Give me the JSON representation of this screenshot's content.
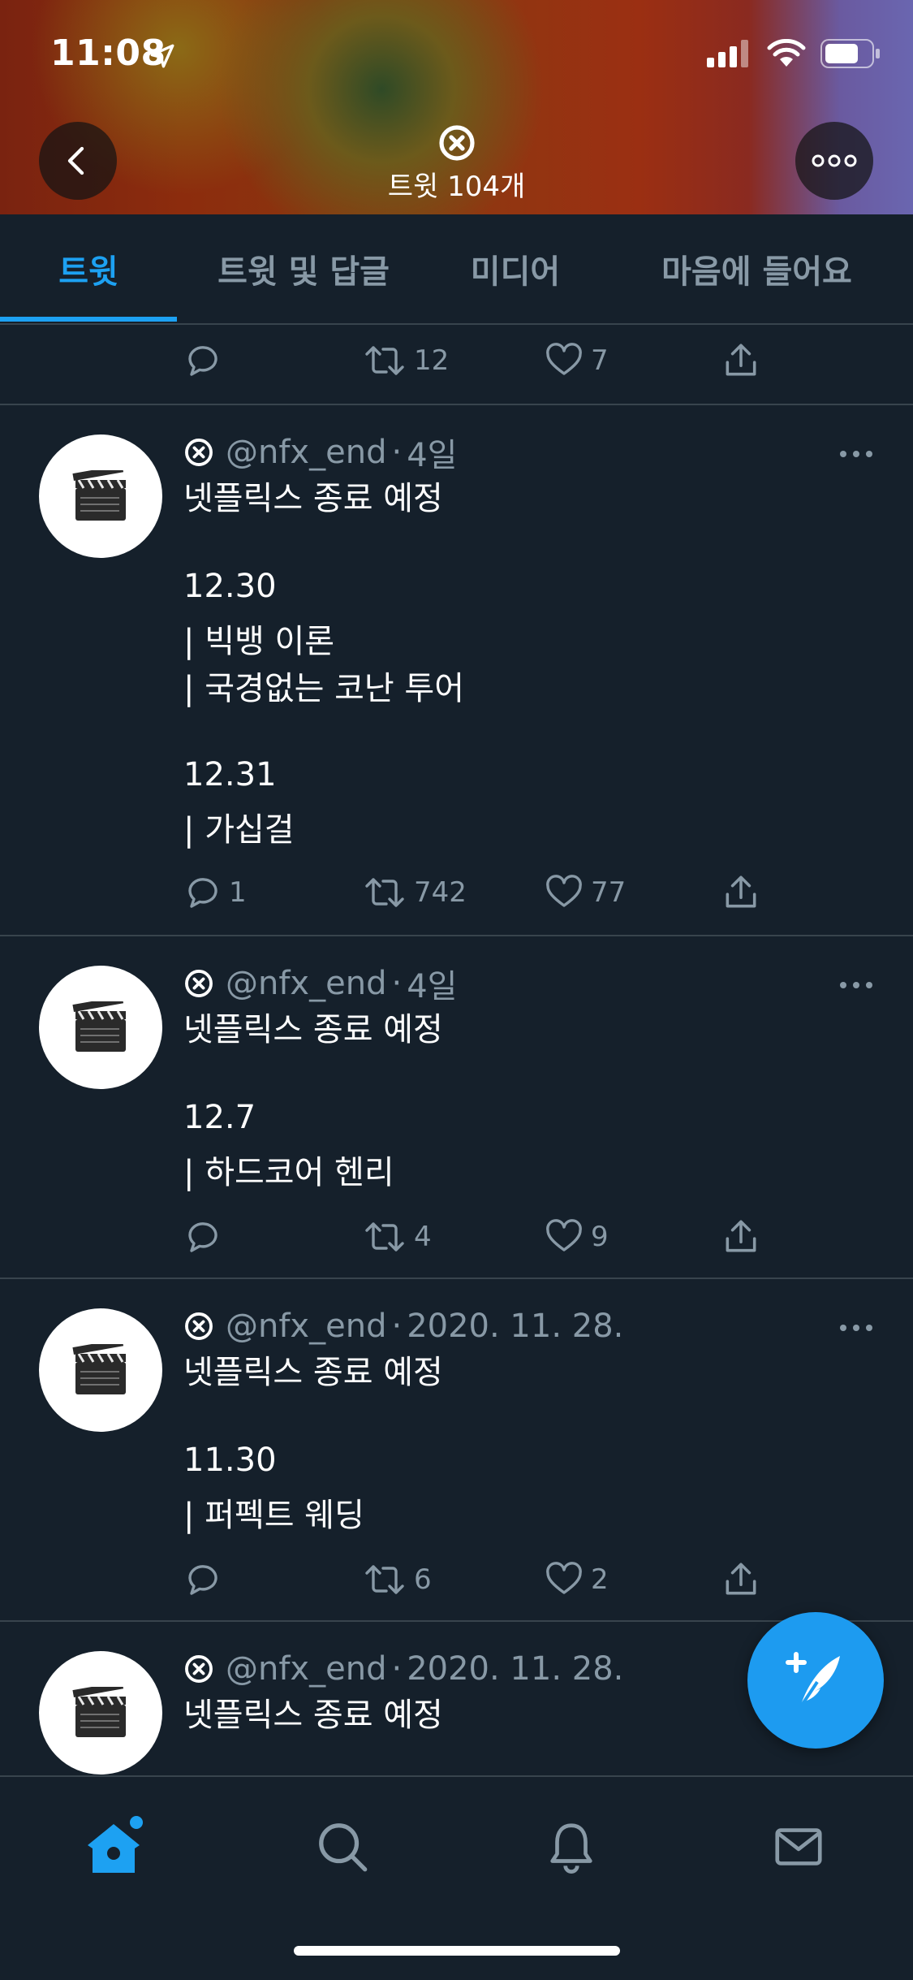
{
  "status_bar": {
    "time": "11:08"
  },
  "header": {
    "tweet_count": "트윗 104개"
  },
  "tabs": [
    {
      "label": "트윗",
      "active": true
    },
    {
      "label": "트윗 및 답글",
      "active": false
    },
    {
      "label": "미디어",
      "active": false
    },
    {
      "label": "마음에 들어요",
      "active": false
    }
  ],
  "partial_tweet_actions": {
    "replies": "",
    "retweets": "12",
    "likes": "7"
  },
  "tweets": [
    {
      "handle": "@nfx_end",
      "time": "4일",
      "lines": [
        "넷플릭스 종료 예정",
        "",
        "12.30",
        "| 빅뱅 이론",
        "| 국경없는 코난 투어",
        "",
        "12.31",
        "| 가십걸"
      ],
      "replies": "1",
      "retweets": "742",
      "likes": "77"
    },
    {
      "handle": "@nfx_end",
      "time": "4일",
      "lines": [
        "넷플릭스 종료 예정",
        "",
        "12.7",
        "| 하드코어 헨리"
      ],
      "replies": "",
      "retweets": "4",
      "likes": "9"
    },
    {
      "handle": "@nfx_end",
      "time": "2020. 11. 28.",
      "lines": [
        "넷플릭스 종료 예정",
        "",
        "11.30",
        "| 퍼펙트 웨딩"
      ],
      "replies": "",
      "retweets": "6",
      "likes": "2"
    },
    {
      "handle": "@nfx_end",
      "time": "2020. 11. 28.",
      "lines": [
        "넷플릭스 종료 예정"
      ]
    }
  ],
  "separator": "·",
  "colors": {
    "accent": "#1da1f2",
    "background": "#15202b",
    "muted": "#8899a6",
    "divider": "#38444d"
  },
  "bottom_nav": [
    {
      "icon": "home-icon",
      "active": true
    },
    {
      "icon": "search-icon",
      "active": false
    },
    {
      "icon": "bell-icon",
      "active": false
    },
    {
      "icon": "mail-icon",
      "active": false
    }
  ]
}
